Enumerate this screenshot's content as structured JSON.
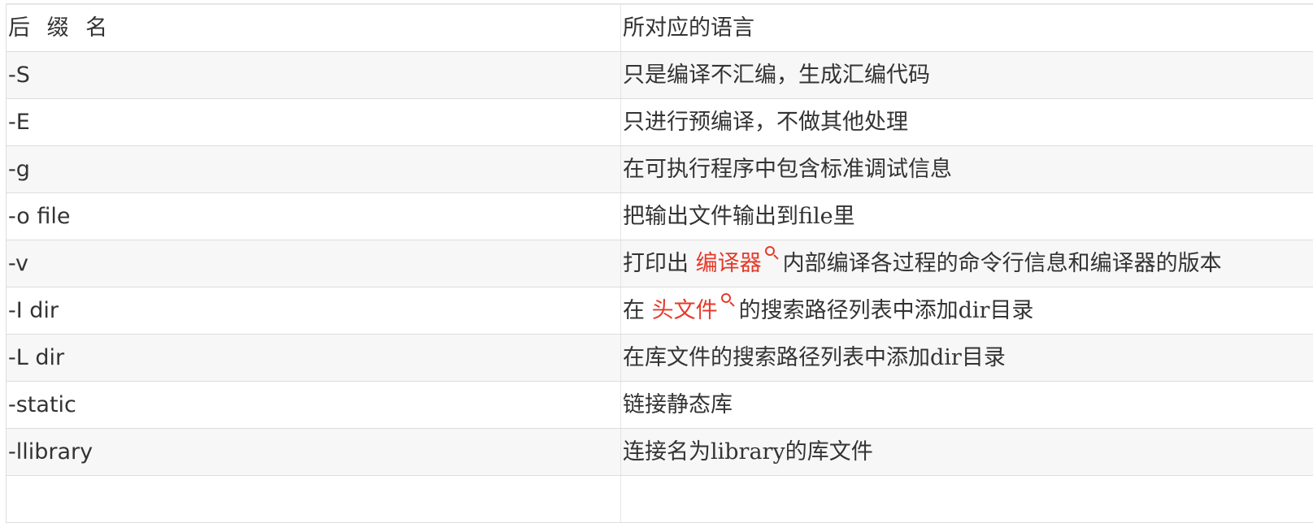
{
  "table": {
    "header": {
      "col1": "后 缀 名",
      "col2": "所对应的语言"
    },
    "rows": [
      {
        "option": "-S",
        "description": "只是编译不汇编，生成汇编代码"
      },
      {
        "option": "-E",
        "description": "只进行预编译，不做其他处理"
      },
      {
        "option": "-g",
        "description": "在可执行程序中包含标准调试信息"
      },
      {
        "option": "-o file",
        "description": "把输出文件输出到file里"
      },
      {
        "option": "-v",
        "desc_prefix": "打印出 ",
        "desc_link": "编译器",
        "desc_suffix": "内部编译各过程的命令行信息和编译器的版本"
      },
      {
        "option": "-I dir",
        "desc_prefix": "在 ",
        "desc_link": "头文件",
        "desc_suffix": "的搜索路径列表中添加dir目录"
      },
      {
        "option": "-L dir",
        "description": "在库文件的搜索路径列表中添加dir目录"
      },
      {
        "option": "-static",
        "description": "链接静态库"
      },
      {
        "option": "-llibrary",
        "description": "连接名为library的库文件"
      }
    ]
  },
  "colors": {
    "link": "#e53a2a",
    "text": "#333333",
    "stripe": "#f7f7f7",
    "border": "#dddddd"
  },
  "icons": {
    "inline_search": "search-icon"
  }
}
